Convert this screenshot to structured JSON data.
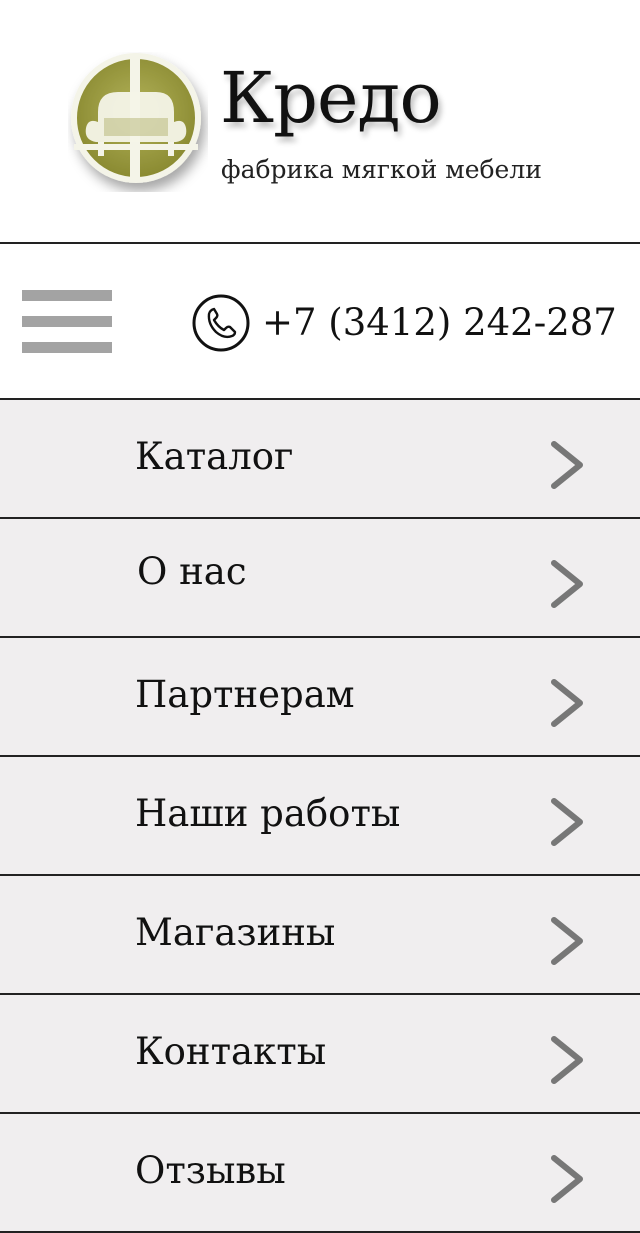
{
  "brand": {
    "name": "Кредо",
    "tagline": "фабрика мягкой мебели",
    "logo_icon": "armchair-logo-icon",
    "logo_color": "#9a9a3c"
  },
  "topbar": {
    "menu_icon": "hamburger-icon",
    "phone_icon": "phone-icon",
    "phone": "+7 (3412) 242-287"
  },
  "menu": {
    "items": [
      {
        "label": "Каталог"
      },
      {
        "label": "О нас"
      },
      {
        "label": "Партнерам"
      },
      {
        "label": "Наши работы"
      },
      {
        "label": "Магазины"
      },
      {
        "label": "Контакты"
      },
      {
        "label": "Отзывы"
      }
    ],
    "chevron_icon": "chevron-right-icon"
  }
}
